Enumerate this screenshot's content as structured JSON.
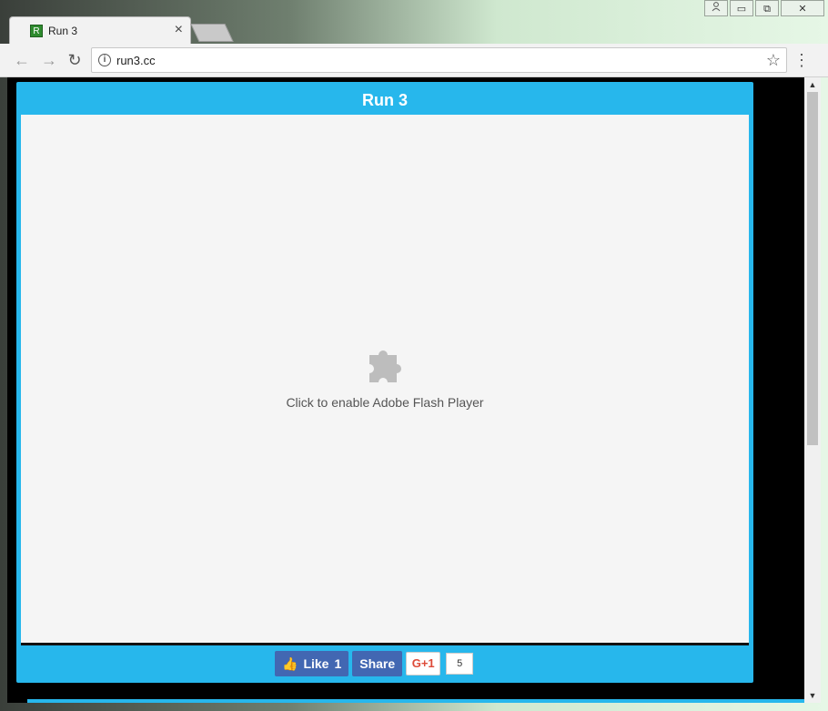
{
  "browser": {
    "tab": {
      "favicon": "R",
      "title": "Run 3"
    },
    "address": {
      "url": "run3.cc"
    }
  },
  "page": {
    "game_title": "Run 3",
    "flash_message": "Click to enable Adobe Flash Player",
    "share": {
      "like_label": "Like",
      "like_count": "1",
      "share_label": "Share",
      "gplus_label": "G+1",
      "gplus_count": "5"
    }
  },
  "icons": [
    "back-arrow-icon",
    "forward-arrow-icon",
    "reload-icon",
    "info-icon",
    "star-icon",
    "menu-dots-icon",
    "puzzle-plugin-icon",
    "thumbs-up-icon",
    "close-icon",
    "user-icon",
    "minimize-icon",
    "maximize-icon"
  ],
  "colors": {
    "accent": "#27b7ec",
    "facebook": "#4267b2",
    "gplus": "#dd4b39"
  }
}
